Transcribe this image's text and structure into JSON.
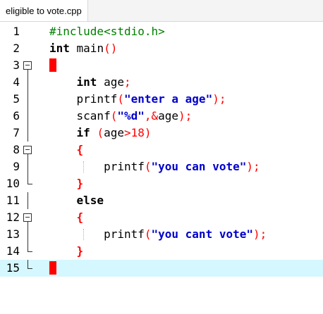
{
  "tab": {
    "title": "eligible to vote.cpp"
  },
  "lines": [
    {
      "num": "1",
      "tokens": [
        {
          "t": "#include<stdio.h>",
          "c": "pp"
        }
      ]
    },
    {
      "num": "2",
      "tokens": [
        {
          "t": "int",
          "c": "kw"
        },
        {
          "t": " main",
          "c": ""
        },
        {
          "t": "()",
          "c": "op"
        }
      ]
    },
    {
      "num": "3",
      "tokens": [
        {
          "t": "{",
          "c": "brace-hi"
        }
      ]
    },
    {
      "num": "4",
      "tokens": [
        {
          "t": "    ",
          "c": ""
        },
        {
          "t": "int",
          "c": "kw"
        },
        {
          "t": " age",
          "c": ""
        },
        {
          "t": ";",
          "c": "op"
        }
      ]
    },
    {
      "num": "5",
      "tokens": [
        {
          "t": "    printf",
          "c": ""
        },
        {
          "t": "(",
          "c": "op"
        },
        {
          "t": "\"enter a age\"",
          "c": "str"
        },
        {
          "t": ");",
          "c": "op"
        }
      ]
    },
    {
      "num": "6",
      "tokens": [
        {
          "t": "    scanf",
          "c": ""
        },
        {
          "t": "(",
          "c": "op"
        },
        {
          "t": "\"%d\"",
          "c": "str"
        },
        {
          "t": ",&",
          "c": "op"
        },
        {
          "t": "age",
          "c": ""
        },
        {
          "t": ");",
          "c": "op"
        }
      ]
    },
    {
      "num": "7",
      "tokens": [
        {
          "t": "    ",
          "c": ""
        },
        {
          "t": "if",
          "c": "kw"
        },
        {
          "t": " ",
          "c": ""
        },
        {
          "t": "(",
          "c": "op"
        },
        {
          "t": "age",
          "c": ""
        },
        {
          "t": ">",
          "c": "op"
        },
        {
          "t": "18",
          "c": "num"
        },
        {
          "t": ")",
          "c": "op"
        }
      ]
    },
    {
      "num": "8",
      "tokens": [
        {
          "t": "    ",
          "c": ""
        },
        {
          "t": "{",
          "c": "brace"
        }
      ]
    },
    {
      "num": "9",
      "tokens": [
        {
          "t": "        printf",
          "c": ""
        },
        {
          "t": "(",
          "c": "op"
        },
        {
          "t": "\"you can vote\"",
          "c": "str"
        },
        {
          "t": ");",
          "c": "op"
        }
      ]
    },
    {
      "num": "10",
      "tokens": [
        {
          "t": "    ",
          "c": ""
        },
        {
          "t": "}",
          "c": "brace"
        }
      ]
    },
    {
      "num": "11",
      "tokens": [
        {
          "t": "    ",
          "c": ""
        },
        {
          "t": "else",
          "c": "kw"
        }
      ]
    },
    {
      "num": "12",
      "tokens": [
        {
          "t": "    ",
          "c": ""
        },
        {
          "t": "{",
          "c": "brace"
        }
      ]
    },
    {
      "num": "13",
      "tokens": [
        {
          "t": "        printf",
          "c": ""
        },
        {
          "t": "(",
          "c": "op"
        },
        {
          "t": "\"you cant vote\"",
          "c": "str"
        },
        {
          "t": ");",
          "c": "op"
        }
      ]
    },
    {
      "num": "14",
      "tokens": [
        {
          "t": "    ",
          "c": ""
        },
        {
          "t": "}",
          "c": "brace"
        }
      ]
    },
    {
      "num": "15",
      "tokens": [
        {
          "t": "}",
          "c": "brace-hi"
        }
      ]
    }
  ],
  "current_line": "15",
  "colors": {
    "current_line_bg": "#d5f7ff",
    "keyword": "#000000",
    "preprocessor": "#008000",
    "string": "#0000cc",
    "operator": "#ff0000"
  }
}
